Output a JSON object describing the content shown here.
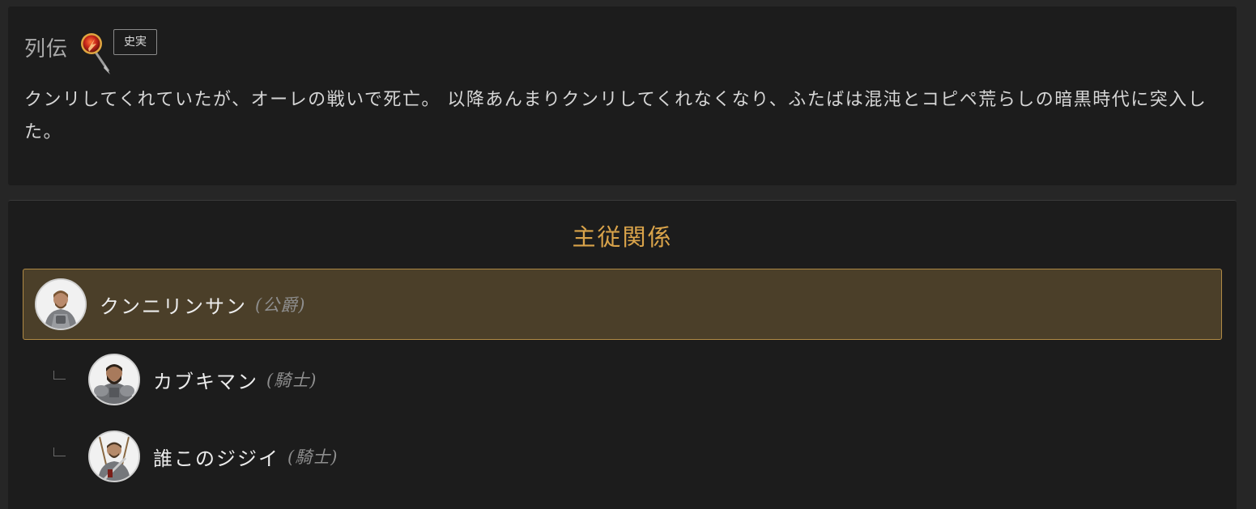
{
  "bio": {
    "title": "列伝",
    "icon": "historical-fact-seal-icon",
    "badge": "史実",
    "text": "クンリしてくれていたが、オーレの戦いで死亡。 以降あんまりクンリしてくれなくなり、ふたばは混沌とコピペ荒らしの暗黒時代に突入した。"
  },
  "relations": {
    "title": "主従関係",
    "lord": {
      "name": "クンニリンサン",
      "rank": "(公爵)",
      "avatar": "knight-portrait-avatar"
    },
    "vassals": [
      {
        "name": "カブキマン",
        "rank": "(騎士)",
        "avatar": "armored-knight-portrait-avatar"
      },
      {
        "name": "誰このジジイ",
        "rank": "(騎士)",
        "avatar": "sword-knight-portrait-avatar"
      }
    ]
  },
  "colors": {
    "background": "#262626",
    "panel": "#1c1c1c",
    "accent_gold": "#d9a34a",
    "lord_highlight_bg": "#4b3f29",
    "lord_highlight_border": "#b08a45",
    "text_primary": "#ececec",
    "text_muted": "#8e8e8e"
  }
}
